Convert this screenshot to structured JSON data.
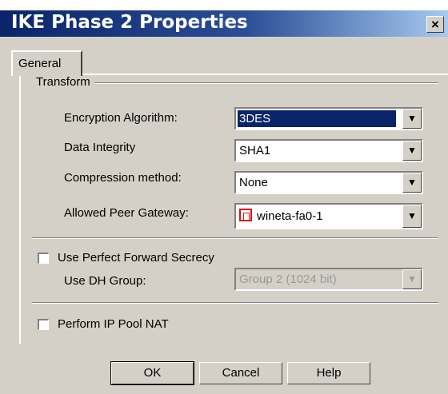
{
  "window": {
    "title": "IKE Phase 2 Properties",
    "close_glyph": "×"
  },
  "tabs": [
    {
      "label": "General"
    }
  ],
  "transform": {
    "group_label": "Transform",
    "encryption": {
      "label": "Encryption Algorithm:",
      "value": "3DES"
    },
    "integrity": {
      "label": "Data Integrity",
      "value": "SHA1"
    },
    "compression": {
      "label": "Compression method:",
      "value": "None"
    },
    "gateway": {
      "label": "Allowed Peer Gateway:",
      "value": "wineta-fa0-1",
      "icon": "gateway-icon"
    }
  },
  "pfs": {
    "checkbox_label": "Use Perfect Forward Secrecy",
    "checked": false,
    "dh_label": "Use DH Group:",
    "dh_value": "Group 2 (1024 bit)"
  },
  "ip_pool_nat": {
    "checkbox_label": "Perform IP Pool NAT",
    "checked": false
  },
  "buttons": {
    "ok": "OK",
    "cancel": "Cancel",
    "help": "Help"
  },
  "arrow_glyph": "▼"
}
